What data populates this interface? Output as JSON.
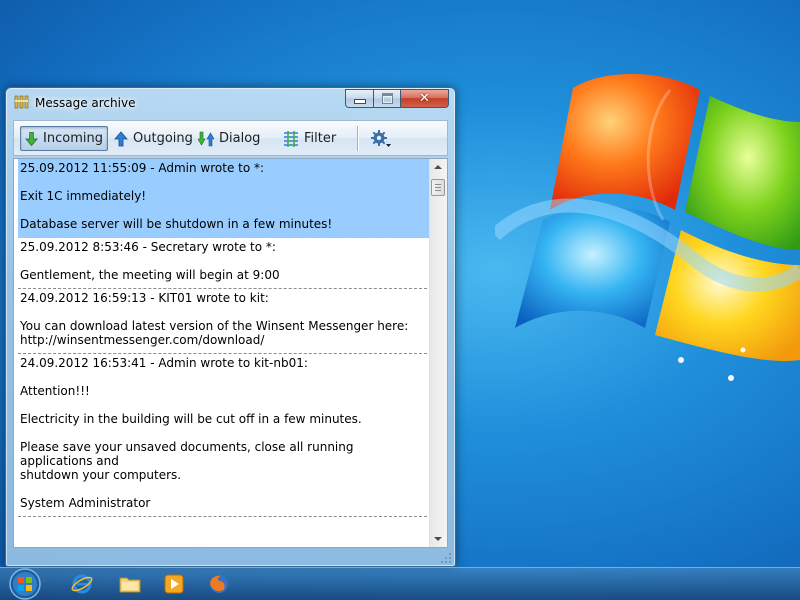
{
  "window": {
    "title": "Message archive",
    "controls": {
      "minimize": "minimize",
      "maximize": "maximize",
      "close": "✕"
    }
  },
  "toolbar": {
    "incoming": "Incoming",
    "outgoing": "Outgoing",
    "dialog": "Dialog",
    "filter": "Filter",
    "active_tab": "incoming"
  },
  "messages": [
    {
      "header": "25.09.2012 11:55:09 - Admin wrote to *:",
      "lines": [
        "Exit 1C immediately!",
        "Database server will be shutdown in a few minutes!"
      ],
      "selected": true
    },
    {
      "header": "25.09.2012 8:53:46 - Secretary wrote to *:",
      "lines": [
        "Gentlement, the meeting will begin at 9:00"
      ],
      "selected": false
    },
    {
      "header": "24.09.2012 16:59:13 - KIT01 wrote to kit:",
      "lines": [
        "You can download latest version of the Winsent Messenger here:\nhttp://winsentmessenger.com/download/"
      ],
      "selected": false
    },
    {
      "header": "24.09.2012 16:53:41 - Admin wrote to kit-nb01:",
      "lines": [
        "Attention!!!",
        "Electricity in the building will be cut off in a few minutes.",
        "Please save your unsaved documents, close all running applications and\nshutdown your computers.",
        "System Administrator"
      ],
      "selected": false
    }
  ],
  "taskbar": {
    "items": [
      "start-orb",
      "internet-explorer-icon",
      "file-explorer-icon",
      "media-player-icon",
      "firefox-icon"
    ]
  },
  "colors": {
    "selection": "#99cdff",
    "desktop": "#1f8fdb",
    "close_button": "#c13f28"
  }
}
